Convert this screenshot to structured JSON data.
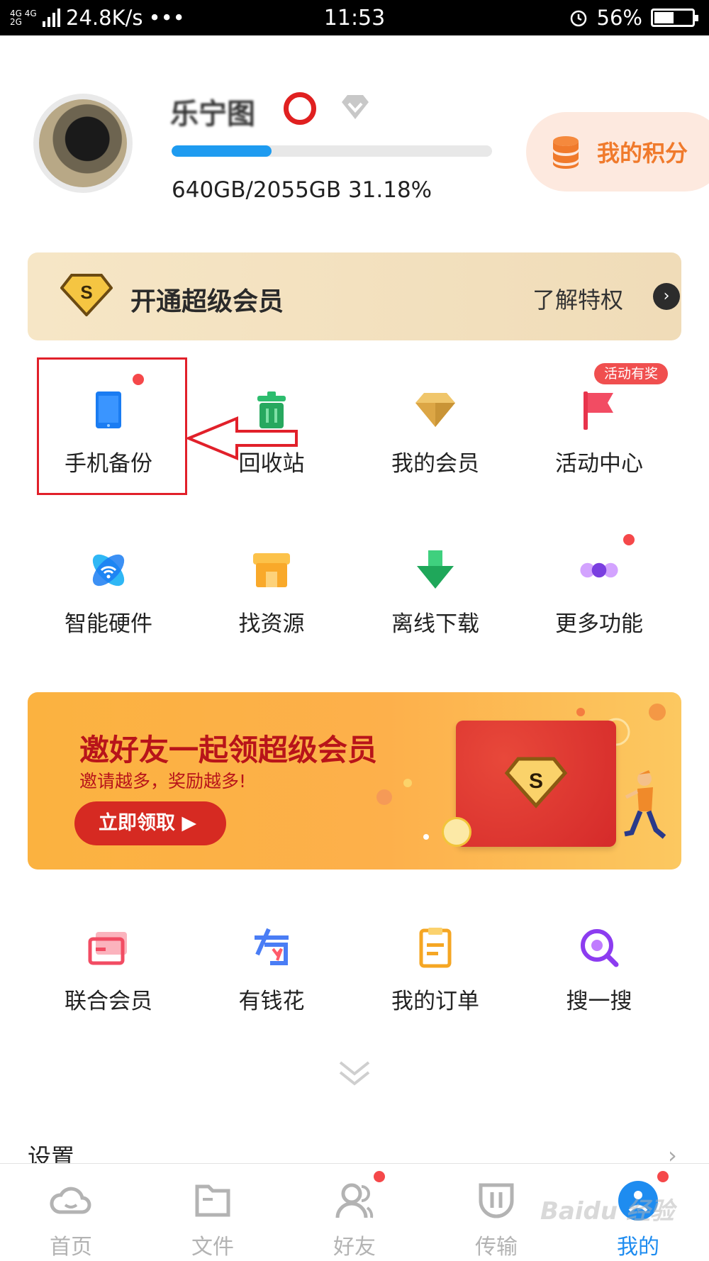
{
  "status_bar": {
    "network": "4G 4G 2G",
    "speed": "24.8K/s",
    "dots": "•••",
    "time": "11:53",
    "battery": "56%",
    "battery_level": 0.56
  },
  "profile": {
    "username": "乐宁图",
    "storage_text": "640GB/2055GB   31.18%",
    "storage_fraction": 0.3118,
    "points_label": "我的积分"
  },
  "vip_banner": {
    "title": "开通超级会员",
    "more": "了解特权",
    "more_icon": "›"
  },
  "grid": {
    "row1": [
      {
        "label": "手机备份",
        "icon": "phone-backup-icon",
        "color": "#1a7cf2"
      },
      {
        "label": "回收站",
        "icon": "trash-icon",
        "color": "#2dbd6e"
      },
      {
        "label": "我的会员",
        "icon": "diamond-icon",
        "color": "#e6b454"
      },
      {
        "label": "活动中心",
        "icon": "flag-icon",
        "color": "#f24c63"
      }
    ],
    "row2": [
      {
        "label": "智能硬件",
        "icon": "smart-hardware-icon",
        "color": "#1e9bf0"
      },
      {
        "label": "找资源",
        "icon": "shop-icon",
        "color": "#fbb13a"
      },
      {
        "label": "离线下载",
        "icon": "download-icon",
        "color": "#27b865"
      },
      {
        "label": "更多功能",
        "icon": "more-dots-icon",
        "color": "#9a5ff0"
      }
    ],
    "row3": [
      {
        "label": "联合会员",
        "icon": "card-icon",
        "color": "#f24c63"
      },
      {
        "label": "有钱花",
        "icon": "money-icon",
        "color": "#4a7df5"
      },
      {
        "label": "我的订单",
        "icon": "order-icon",
        "color": "#f5a623"
      },
      {
        "label": "搜一搜",
        "icon": "search-icon",
        "color": "#9a3cf0"
      }
    ],
    "promo_tag": "活动有奖"
  },
  "invite": {
    "title": "邀好友一起领超级会员",
    "subtitle": "邀请越多，奖励越多!",
    "cta": "立即领取 ▶"
  },
  "settings": {
    "label": "设置",
    "arrow": "›"
  },
  "tabbar": {
    "tabs": [
      {
        "label": "首页",
        "icon": "home-cloud-icon"
      },
      {
        "label": "文件",
        "icon": "folder-icon"
      },
      {
        "label": "好友",
        "icon": "friends-icon"
      },
      {
        "label": "传输",
        "icon": "transfer-icon"
      },
      {
        "label": "我的",
        "icon": "me-icon"
      }
    ],
    "active_index": 4
  },
  "watermark": "Baidu 经验"
}
